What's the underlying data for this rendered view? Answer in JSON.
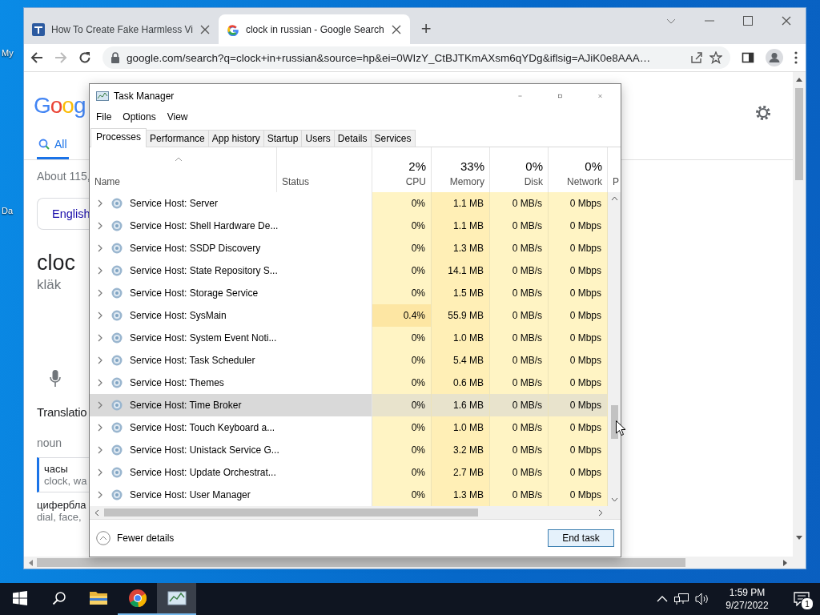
{
  "desktop": {
    "icon_labels": [
      "My",
      "Da"
    ]
  },
  "browser": {
    "tabs": [
      {
        "title": "How To Create Fake Harmless Vi",
        "selected": false
      },
      {
        "title": "clock in russian - Google Search",
        "selected": true
      }
    ],
    "new_tab": "+",
    "address": "google.com/search?q=clock+in+russian&source=hp&ei=0WIzY_CtBJTKmAXsm6qYDg&iflsig=AJiK0e8AAA…",
    "forward_disabled": true
  },
  "google": {
    "logo": "Goog",
    "nav_tabs": [
      {
        "label": "All",
        "selected": true
      }
    ],
    "result_stats": "About 115,",
    "language_chip": "English",
    "word": "cloc",
    "pronunciation": "kläk",
    "translations_heading": "Translatio",
    "part_of_speech": "noun",
    "entries": [
      {
        "term": "часы",
        "gloss": "clock, wa",
        "highlighted": true
      },
      {
        "term": "цифербла",
        "gloss": "dial, face,",
        "highlighted": false
      }
    ]
  },
  "task_manager": {
    "title": "Task Manager",
    "menu": [
      "File",
      "Options",
      "View"
    ],
    "tabs": [
      {
        "label": "Processes",
        "selected": true
      },
      {
        "label": "Performance",
        "selected": false
      },
      {
        "label": "App history",
        "selected": false
      },
      {
        "label": "Startup",
        "selected": false
      },
      {
        "label": "Users",
        "selected": false
      },
      {
        "label": "Details",
        "selected": false
      },
      {
        "label": "Services",
        "selected": false
      }
    ],
    "columns": [
      {
        "label": "Name"
      },
      {
        "label": "Status"
      },
      {
        "label": "CPU",
        "total": "2%"
      },
      {
        "label": "Memory",
        "total": "33%"
      },
      {
        "label": "Disk",
        "total": "0%"
      },
      {
        "label": "Network",
        "total": "0%"
      },
      {
        "label": "P"
      }
    ],
    "rows": [
      {
        "name": "Service Host: Server",
        "cpu": "0%",
        "memory": "1.1 MB",
        "disk": "0 MB/s",
        "network": "0 Mbps",
        "selected": false,
        "cpu_busy": false
      },
      {
        "name": "Service Host: Shell Hardware De...",
        "cpu": "0%",
        "memory": "1.1 MB",
        "disk": "0 MB/s",
        "network": "0 Mbps",
        "selected": false,
        "cpu_busy": false
      },
      {
        "name": "Service Host: SSDP Discovery",
        "cpu": "0%",
        "memory": "1.3 MB",
        "disk": "0 MB/s",
        "network": "0 Mbps",
        "selected": false,
        "cpu_busy": false
      },
      {
        "name": "Service Host: State Repository S...",
        "cpu": "0%",
        "memory": "14.1 MB",
        "disk": "0 MB/s",
        "network": "0 Mbps",
        "selected": false,
        "cpu_busy": false
      },
      {
        "name": "Service Host: Storage Service",
        "cpu": "0%",
        "memory": "1.5 MB",
        "disk": "0 MB/s",
        "network": "0 Mbps",
        "selected": false,
        "cpu_busy": false
      },
      {
        "name": "Service Host: SysMain",
        "cpu": "0.4%",
        "memory": "55.9 MB",
        "disk": "0 MB/s",
        "network": "0 Mbps",
        "selected": false,
        "cpu_busy": true
      },
      {
        "name": "Service Host: System Event Noti...",
        "cpu": "0%",
        "memory": "1.0 MB",
        "disk": "0 MB/s",
        "network": "0 Mbps",
        "selected": false,
        "cpu_busy": false
      },
      {
        "name": "Service Host: Task Scheduler",
        "cpu": "0%",
        "memory": "5.4 MB",
        "disk": "0 MB/s",
        "network": "0 Mbps",
        "selected": false,
        "cpu_busy": false
      },
      {
        "name": "Service Host: Themes",
        "cpu": "0%",
        "memory": "0.6 MB",
        "disk": "0 MB/s",
        "network": "0 Mbps",
        "selected": false,
        "cpu_busy": false
      },
      {
        "name": "Service Host: Time Broker",
        "cpu": "0%",
        "memory": "1.6 MB",
        "disk": "0 MB/s",
        "network": "0 Mbps",
        "selected": true,
        "cpu_busy": false
      },
      {
        "name": "Service Host: Touch Keyboard a...",
        "cpu": "0%",
        "memory": "1.0 MB",
        "disk": "0 MB/s",
        "network": "0 Mbps",
        "selected": false,
        "cpu_busy": false
      },
      {
        "name": "Service Host: Unistack Service G...",
        "cpu": "0%",
        "memory": "3.2 MB",
        "disk": "0 MB/s",
        "network": "0 Mbps",
        "selected": false,
        "cpu_busy": false
      },
      {
        "name": "Service Host: Update Orchestrat...",
        "cpu": "0%",
        "memory": "2.7 MB",
        "disk": "0 MB/s",
        "network": "0 Mbps",
        "selected": false,
        "cpu_busy": false
      },
      {
        "name": "Service Host: User Manager",
        "cpu": "0%",
        "memory": "1.3 MB",
        "disk": "0 MB/s",
        "network": "0 Mbps",
        "selected": false,
        "cpu_busy": false
      }
    ],
    "fewer_details": "Fewer details",
    "end_task": "End task"
  },
  "taskbar": {
    "apps": [
      {
        "kind": "folder",
        "running": false,
        "selected": false
      },
      {
        "kind": "browser",
        "running": true,
        "selected": false
      },
      {
        "kind": "task-manager",
        "running": true,
        "selected": true
      }
    ],
    "time": "1:59 PM",
    "date": "9/27/2022",
    "notification_count": "1"
  }
}
